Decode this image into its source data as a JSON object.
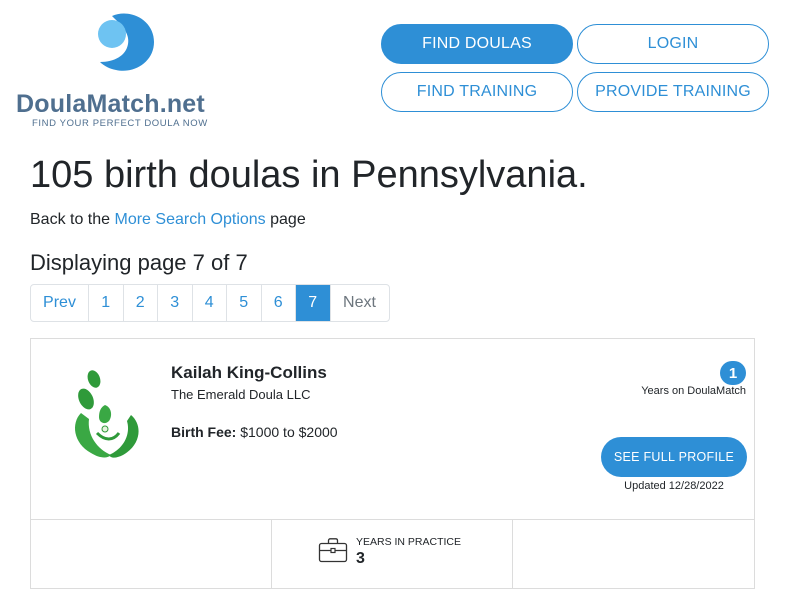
{
  "header": {
    "logo_text_main": "DoulaMatch",
    "logo_text_tld": ".net",
    "logo_tagline": "FIND YOUR PERFECT DOULA NOW",
    "nav": {
      "find_doulas": "FIND DOULAS",
      "login": "LOGIN",
      "find_training": "FIND TRAINING",
      "provide_training": "PROVIDE TRAINING"
    }
  },
  "main": {
    "title": "105 birth doulas in Pennsylvania.",
    "back_prefix": "Back to the ",
    "back_link": "More Search Options",
    "back_suffix": " page",
    "display_text": "Displaying page 7 of 7"
  },
  "pagination": {
    "prev": "Prev",
    "pages": [
      "1",
      "2",
      "3",
      "4",
      "5",
      "6",
      "7"
    ],
    "active_page": "7",
    "next": "Next"
  },
  "result": {
    "name": "Kailah King-Collins",
    "business": "The Emerald Doula LLC",
    "fee_label": "Birth Fee:",
    "fee_value": " $1000 to $2000",
    "years_on_site": "1",
    "years_on_site_label": "Years on DoulaMatch",
    "profile_button": "SEE FULL PROFILE",
    "updated": "Updated 12/28/2022",
    "stats": {
      "practice_label": "YEARS IN PRACTICE",
      "practice_value": "3",
      "icon": "briefcase-icon"
    }
  },
  "colors": {
    "accent": "#2e8fd6",
    "logo_text": "#4f6f8f",
    "photo_green": "#2f9a3a"
  }
}
